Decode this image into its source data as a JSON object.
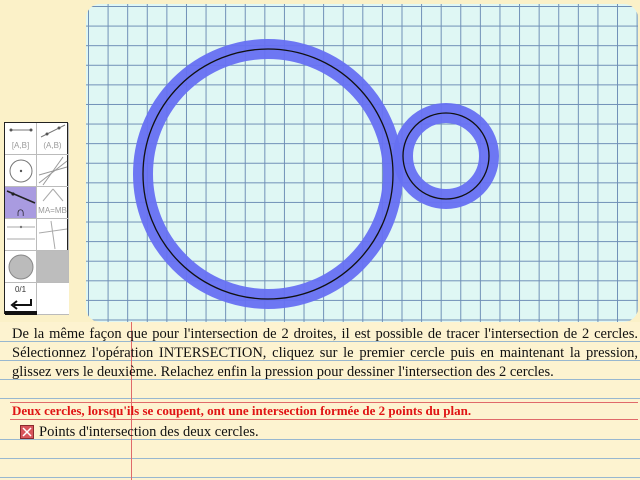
{
  "palette": {
    "tools": [
      {
        "name": "tool-segment",
        "label": "[A,B]"
      },
      {
        "name": "tool-ray",
        "label": "(A,B)"
      },
      {
        "name": "tool-circle",
        "label": ""
      },
      {
        "name": "tool-lines",
        "label": ""
      },
      {
        "name": "tool-intersection",
        "label": "∩"
      },
      {
        "name": "tool-midpoint",
        "label": "MA=MB"
      },
      {
        "name": "tool-parallel",
        "label": ""
      },
      {
        "name": "tool-perpendicular",
        "label": ""
      },
      {
        "name": "tool-color",
        "label": ""
      },
      {
        "name": "tool-gray",
        "label": ""
      },
      {
        "name": "tool-counter",
        "label": "0/1"
      },
      {
        "name": "tool-blank",
        "label": ""
      }
    ],
    "counter_label": "0/1",
    "undo_icon": "undo-arrow-icon",
    "selected_tool": "tool-intersection"
  },
  "instructions": "De la même façon que pour l'intersection de 2 droites, il est possible de tracer l'intersection de 2 cercles. Sélectionnez l'opération INTERSECTION, cliquez sur le premier cercle puis en maintenant la pression, glissez vers le deuxième. Relachez enfin la pression pour dessiner l'intersection des 2 cercles.",
  "rule": "Deux cercles, lorsqu'ils se coupent, ont une intersection formée de 2 points du plan.",
  "task": {
    "label": "Points d'intersection des deux cercles.",
    "icon": "cross-checkbox-icon"
  },
  "colors": {
    "highlight": "#6670f2",
    "grid": "#6f8fb6",
    "rule_text": "#e01414"
  }
}
